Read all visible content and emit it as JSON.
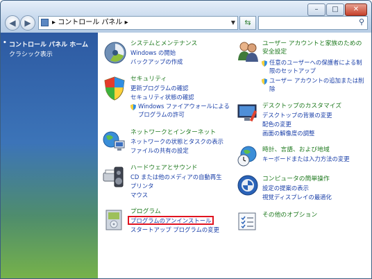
{
  "address": {
    "items": [
      "コントロール パネル"
    ],
    "separator": "▸"
  },
  "sidebar": {
    "items": [
      {
        "label": "コントロール パネル ホーム",
        "current": true
      },
      {
        "label": "クラシック表示",
        "current": false
      }
    ]
  },
  "categories": [
    {
      "id": "system",
      "icon": "system-maintenance-icon",
      "title": "システムとメンテナンス",
      "links": [
        "Windows の開始",
        "バックアップの作成"
      ]
    },
    {
      "id": "security",
      "icon": "security-shield-icon",
      "title": "セキュリティ",
      "links": [
        "更新プログラムの確認",
        "セキュリティ状態の確認"
      ],
      "shield_link": [
        "Windows ファイアウォールによる",
        "プログラムの許可"
      ]
    },
    {
      "id": "network",
      "icon": "network-internet-icon",
      "title": "ネットワークとインターネット",
      "links": [
        "ネットワークの状態とタスクの表示",
        "ファイルの共有の設定"
      ]
    },
    {
      "id": "hardware",
      "icon": "hardware-sound-icon",
      "title": "ハードウェアとサウンド",
      "links": [
        "CD または他のメディアの自動再生",
        "プリンタ",
        "マウス"
      ]
    },
    {
      "id": "programs",
      "icon": "programs-icon",
      "title": "プログラム",
      "links": [
        "プログラムのアンインストール",
        "スタートアップ プログラムの変更"
      ],
      "highlight": 0
    },
    {
      "id": "users",
      "icon": "user-accounts-icon",
      "title": [
        "ユーザー アカウントと家族のための",
        "安全設定"
      ],
      "shield_links": [
        [
          "任意のユーザーへの保護者による制",
          "限のセットアップ"
        ],
        [
          "ユーザー アカウントの追加または削",
          "除"
        ]
      ]
    },
    {
      "id": "desktop",
      "icon": "appearance-personalization-icon",
      "title": "デスクトップのカスタマイズ",
      "links": [
        "デスクトップの背景の変更",
        "配色の変更",
        "画面の解像度の調整"
      ]
    },
    {
      "id": "clock",
      "icon": "clock-language-region-icon",
      "title": "時計、言語、および地域",
      "links": [
        "キーボードまたは入力方法の変更"
      ]
    },
    {
      "id": "ease",
      "icon": "ease-of-access-icon",
      "title": "コンピュータの簡単操作",
      "links": [
        "設定の提案の表示",
        "視覚ディスプレイの最適化"
      ]
    },
    {
      "id": "other",
      "icon": "additional-options-icon",
      "title": "その他のオプション",
      "links": []
    }
  ],
  "colors": {
    "link": "#1a3fa8",
    "heading": "#1f7a1f",
    "highlight": "#e0131f"
  }
}
